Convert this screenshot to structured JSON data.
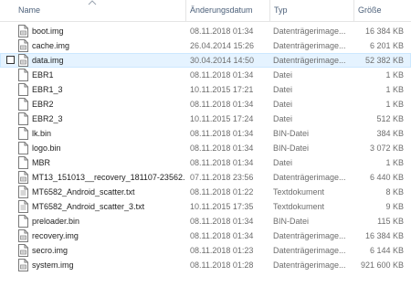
{
  "columns": {
    "name": "Name",
    "date": "Änderungsdatum",
    "type": "Typ",
    "size": "Größe"
  },
  "files": [
    {
      "name": "boot.img",
      "date": "08.11.2018 01:34",
      "type": "Datenträgerimage...",
      "size": "16 384 KB",
      "icon": "disk-image-icon",
      "selected": false
    },
    {
      "name": "cache.img",
      "date": "26.04.2014 15:26",
      "type": "Datenträgerimage...",
      "size": "6 201 KB",
      "icon": "disk-image-icon",
      "selected": false
    },
    {
      "name": "data.img",
      "date": "30.04.2014 14:50",
      "type": "Datenträgerimage...",
      "size": "52 382 KB",
      "icon": "disk-image-icon",
      "selected": true
    },
    {
      "name": "EBR1",
      "date": "08.11.2018 01:34",
      "type": "Datei",
      "size": "1 KB",
      "icon": "file-icon",
      "selected": false
    },
    {
      "name": "EBR1_3",
      "date": "10.11.2015 17:21",
      "type": "Datei",
      "size": "1 KB",
      "icon": "file-icon",
      "selected": false
    },
    {
      "name": "EBR2",
      "date": "08.11.2018 01:34",
      "type": "Datei",
      "size": "1 KB",
      "icon": "file-icon",
      "selected": false
    },
    {
      "name": "EBR2_3",
      "date": "10.11.2015 17:24",
      "type": "Datei",
      "size": "512 KB",
      "icon": "file-icon",
      "selected": false
    },
    {
      "name": "lk.bin",
      "date": "08.11.2018 01:34",
      "type": "BIN-Datei",
      "size": "384 KB",
      "icon": "file-icon",
      "selected": false
    },
    {
      "name": "logo.bin",
      "date": "08.11.2018 01:34",
      "type": "BIN-Datei",
      "size": "3 072 KB",
      "icon": "file-icon",
      "selected": false
    },
    {
      "name": "MBR",
      "date": "08.11.2018 01:34",
      "type": "Datei",
      "size": "1 KB",
      "icon": "file-icon",
      "selected": false
    },
    {
      "name": "MT13_151013__recovery_181107-23562...",
      "date": "07.11.2018 23:56",
      "type": "Datenträgerimage...",
      "size": "6 440 KB",
      "icon": "disk-image-icon",
      "selected": false
    },
    {
      "name": "MT6582_Android_scatter.txt",
      "date": "08.11.2018 01:22",
      "type": "Textdokument",
      "size": "8 KB",
      "icon": "text-document-icon",
      "selected": false
    },
    {
      "name": "MT6582_Android_scatter_3.txt",
      "date": "10.11.2015 17:35",
      "type": "Textdokument",
      "size": "9 KB",
      "icon": "text-document-icon",
      "selected": false
    },
    {
      "name": "preloader.bin",
      "date": "08.11.2018 01:34",
      "type": "BIN-Datei",
      "size": "115 KB",
      "icon": "file-icon",
      "selected": false
    },
    {
      "name": "recovery.img",
      "date": "08.11.2018 01:34",
      "type": "Datenträgerimage...",
      "size": "16 384 KB",
      "icon": "disk-image-icon",
      "selected": false
    },
    {
      "name": "secro.img",
      "date": "08.11.2018 01:23",
      "type": "Datenträgerimage...",
      "size": "6 144 KB",
      "icon": "disk-image-icon",
      "selected": false
    },
    {
      "name": "system.img",
      "date": "08.11.2018 01:28",
      "type": "Datenträgerimage...",
      "size": "921 600 KB",
      "icon": "disk-image-icon",
      "selected": false
    }
  ],
  "colors": {
    "header_text": "#4c607a",
    "selection_bg": "#e5f3ff",
    "selection_border": "#cce8ff",
    "secondary_text": "#6d6d6d"
  }
}
